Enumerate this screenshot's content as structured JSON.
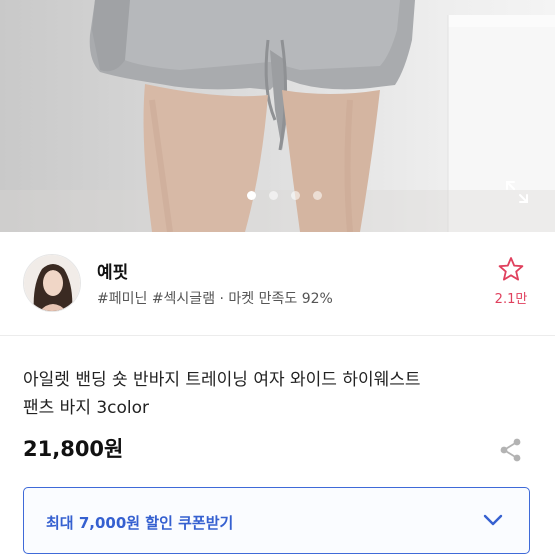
{
  "product_image": {
    "page_count": 4,
    "active_page": 1,
    "expand_icon": "expand-icon"
  },
  "seller": {
    "name": "예핏",
    "tags": "#페미닌 #섹시글램 · 마켓 만족도 92%",
    "favorite_icon": "star-outline-icon",
    "favorite_count": "2.1만",
    "accent_color": "#e0405d"
  },
  "product": {
    "title_line1": "아일렛 밴딩 숏 반바지 트레이닝 여자 와이드 하이웨스트",
    "title_line2": "팬츠 바지 3color",
    "price": "21,800원",
    "share_icon": "share-icon"
  },
  "coupon": {
    "label": "최대 7,000원 할인 쿠폰받기",
    "chevron_icon": "chevron-down-icon",
    "accent_color": "#3560d0"
  }
}
